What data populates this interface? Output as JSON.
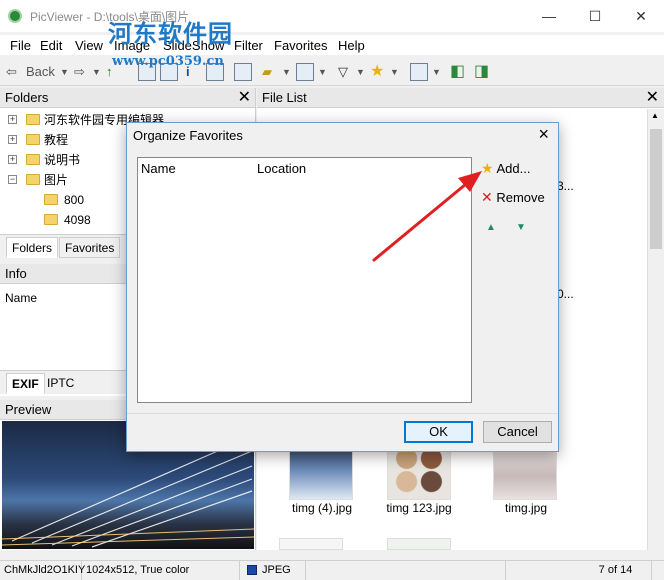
{
  "titlebar": {
    "title": "PicViewer - D:\\tools\\桌面\\图片",
    "minimize": "—",
    "maximize": "☐",
    "close": "✕"
  },
  "watermark": {
    "logo": "河东软件园",
    "url": "www.pc0359.cn"
  },
  "menubar": {
    "items": [
      "File",
      "Edit",
      "View",
      "Image",
      "SlideShow",
      "Filter",
      "Favorites",
      "Help"
    ]
  },
  "toolbar": {
    "back_label": "Back"
  },
  "folders": {
    "title": "Folders",
    "tree": [
      {
        "label": "河东软件园专用编辑器"
      },
      {
        "label": "教程"
      },
      {
        "label": "说明书"
      },
      {
        "label": "图片"
      },
      {
        "label": "800"
      },
      {
        "label": "4098"
      }
    ],
    "tabs": [
      "Folders",
      "Favorites"
    ]
  },
  "info": {
    "title": "Info",
    "name_label": "Name",
    "tabs": [
      "EXIF",
      "IPTC"
    ]
  },
  "preview": {
    "title": "Preview"
  },
  "filelist": {
    "title": "File List",
    "partial_labels": [
      "3...",
      "0..."
    ],
    "thumbs": [
      {
        "label": "timg (4).jpg"
      },
      {
        "label": "timg 123.jpg"
      },
      {
        "label": "timg.jpg"
      }
    ]
  },
  "statusbar": {
    "filename": "ChMkJld2O1KIY",
    "dimensions": "1024x512, True color",
    "format": "JPEG",
    "count": "7 of 14"
  },
  "dialog": {
    "title": "Organize Favorites",
    "columns": [
      "Name",
      "Location"
    ],
    "add_label": "Add...",
    "remove_label": "Remove",
    "ok_label": "OK",
    "cancel_label": "Cancel"
  },
  "colors": {
    "accent": "#0078d7",
    "arrow": "#e02020",
    "watermark": "#1f79c7"
  }
}
